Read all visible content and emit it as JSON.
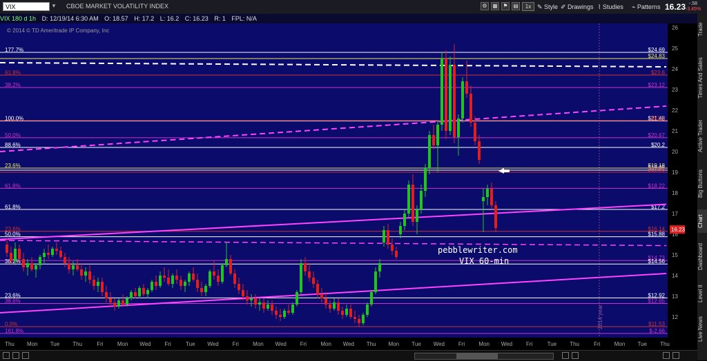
{
  "toolbar": {
    "symbol": "VIX",
    "title": "CBOE MARKET VOLATILITY INDEX",
    "buttons": [
      "1x",
      "Style",
      "Drawings",
      "Studies",
      "Patterns"
    ],
    "last_price": "16.23",
    "change": "-.58",
    "change_pct": "-3.45%"
  },
  "infobar": {
    "name": "VIX 180 d 1h",
    "date": "D: 12/19/14 6:30 AM",
    "open": "O: 18.57",
    "high": "H: 17.2",
    "low": "L: 16.2",
    "close": "C: 16.23",
    "range": "R: 1",
    "fpl": "FPL: N/A"
  },
  "copyright": "© 2014 © TD Ameritrade IP Company, Inc",
  "side_tabs": [
    "Trade",
    "Times And Sales",
    "Active Trader",
    "Big Buttons",
    "Chart",
    "Dashboard",
    "Level II",
    "Live News"
  ],
  "watermark": {
    "site": "pebblewriter.com",
    "caption": "VIX 60-min"
  },
  "vertical_marker": "2014 year",
  "chart_data": {
    "type": "candlestick",
    "ylim": [
      11,
      26.2
    ],
    "y_ticks": [
      12,
      13,
      14,
      15,
      16,
      17,
      18,
      19,
      20,
      21,
      22,
      23,
      24,
      25,
      26
    ],
    "x_labels": [
      "Thu",
      "Mon",
      "Tue",
      "Thu",
      "Fri",
      "Mon",
      "Wed",
      "Fri",
      "Tue",
      "Wed",
      "Fri",
      "Mon",
      "Wed",
      "Fri",
      "Mon",
      "Wed",
      "Thu",
      "Mon",
      "Tue",
      "Wed",
      "Fri",
      "Mon",
      "Wed",
      "Fri",
      "Tue",
      "Thu",
      "Fri",
      "Mon",
      "Tue",
      "Thu"
    ],
    "last_price_tag": "16.23",
    "level_lines": [
      {
        "y": 24.8,
        "left": "177.7%",
        "right": "$24.69",
        "color": "#ffffff"
      },
      {
        "y": 24.5,
        "left": "",
        "right": "$24.83",
        "color": "#e8e860"
      },
      {
        "y": 23.7,
        "left": "61.8%",
        "right": "$23.6",
        "color": "#cc3333"
      },
      {
        "y": 23.1,
        "left": "38.2%",
        "right": "$23.12",
        "color": "#cc33cc"
      },
      {
        "y": 21.48,
        "left": "100.0%",
        "right": "$21.48",
        "color": "#ffffff"
      },
      {
        "y": 21.5,
        "left": "",
        "right": "$21.4",
        "color": "#cc3333"
      },
      {
        "y": 20.67,
        "left": "50.0%",
        "right": "$20.67",
        "color": "#cc33cc"
      },
      {
        "y": 20.2,
        "left": "88.6%",
        "right": "$20.2",
        "color": "#ffffff"
      },
      {
        "y": 19.2,
        "left": "23.6%",
        "right": "$19.18",
        "color": "#e8e860"
      },
      {
        "y": 19.1,
        "left": "",
        "right": "$19.08",
        "color": "#ffffff"
      },
      {
        "y": 19.0,
        "left": "",
        "right": "$18.98",
        "color": "#cc3333"
      },
      {
        "y": 18.22,
        "left": "61.8%",
        "right": "$18.22",
        "color": "#cc33cc"
      },
      {
        "y": 17.2,
        "left": "61.8%",
        "right": "$17.2",
        "color": "#ffffff"
      },
      {
        "y": 16.14,
        "left": "23.6%",
        "right": "$16.14",
        "color": "#cc3333"
      },
      {
        "y": 15.88,
        "left": "50.0%",
        "right": "$15.88",
        "color": "#ffffff"
      },
      {
        "y": 14.73,
        "left": "",
        "right": "$14.73",
        "color": "#cc33cc"
      },
      {
        "y": 14.56,
        "left": "38.2%",
        "right": "$14.56",
        "color": "#ffffff"
      },
      {
        "y": 12.92,
        "left": "23.6%",
        "right": "$12.92",
        "color": "#ffffff"
      },
      {
        "y": 12.65,
        "left": "38.6%",
        "right": "$12.65",
        "color": "#cc33cc"
      },
      {
        "y": 11.53,
        "left": "0.0%",
        "right": "$11.53",
        "color": "#cc3333"
      },
      {
        "y": 11.2,
        "left": "161.8%",
        "right": "$-2.66",
        "color": "#cc33cc"
      }
    ],
    "trendlines": [
      {
        "x": [
          0,
          965
        ],
        "y": [
          15.75,
          17.45
        ],
        "color": "#ff44ff",
        "width": 2,
        "dash": false
      },
      {
        "x": [
          0,
          965
        ],
        "y": [
          12.2,
          14.1
        ],
        "color": "#ff44ff",
        "width": 2,
        "dash": false
      },
      {
        "x": [
          0,
          965
        ],
        "y": [
          20.0,
          22.2
        ],
        "color": "#ff44ff",
        "width": 2,
        "dash": true
      },
      {
        "x": [
          0,
          965
        ],
        "y": [
          15.7,
          15.45
        ],
        "color": "#ff44ff",
        "width": 1.5,
        "dash": true
      },
      {
        "x": [
          0,
          965
        ],
        "y": [
          24.3,
          24.1
        ],
        "color": "#ffffff",
        "width": 2,
        "dash": true
      }
    ],
    "candles": [
      {
        "x": 10,
        "o": 15.5,
        "h": 15.8,
        "l": 14.9,
        "c": 15.1
      },
      {
        "x": 16,
        "o": 15.1,
        "h": 15.4,
        "l": 14.5,
        "c": 14.7
      },
      {
        "x": 22,
        "o": 14.7,
        "h": 15.6,
        "l": 14.5,
        "c": 15.3
      },
      {
        "x": 28,
        "o": 15.3,
        "h": 15.5,
        "l": 14.6,
        "c": 14.8
      },
      {
        "x": 34,
        "o": 14.8,
        "h": 15.1,
        "l": 14.2,
        "c": 14.4
      },
      {
        "x": 40,
        "o": 14.4,
        "h": 14.8,
        "l": 14.0,
        "c": 14.6
      },
      {
        "x": 46,
        "o": 14.6,
        "h": 14.9,
        "l": 14.2,
        "c": 14.3
      },
      {
        "x": 52,
        "o": 14.3,
        "h": 14.6,
        "l": 13.9,
        "c": 14.5
      },
      {
        "x": 58,
        "o": 14.5,
        "h": 15.0,
        "l": 14.3,
        "c": 14.9
      },
      {
        "x": 64,
        "o": 14.9,
        "h": 15.3,
        "l": 14.6,
        "c": 15.1
      },
      {
        "x": 70,
        "o": 15.1,
        "h": 15.5,
        "l": 14.8,
        "c": 15.0
      },
      {
        "x": 76,
        "o": 15.0,
        "h": 15.4,
        "l": 14.9,
        "c": 15.3
      },
      {
        "x": 82,
        "o": 15.3,
        "h": 15.6,
        "l": 15.0,
        "c": 15.2
      },
      {
        "x": 88,
        "o": 15.2,
        "h": 15.4,
        "l": 14.8,
        "c": 14.9
      },
      {
        "x": 94,
        "o": 14.9,
        "h": 15.1,
        "l": 14.4,
        "c": 14.6
      },
      {
        "x": 100,
        "o": 14.6,
        "h": 14.9,
        "l": 14.1,
        "c": 14.3
      },
      {
        "x": 106,
        "o": 14.3,
        "h": 14.7,
        "l": 14.0,
        "c": 14.5
      },
      {
        "x": 112,
        "o": 14.5,
        "h": 14.8,
        "l": 14.2,
        "c": 14.3
      },
      {
        "x": 118,
        "o": 14.3,
        "h": 14.6,
        "l": 13.8,
        "c": 14.0
      },
      {
        "x": 124,
        "o": 14.0,
        "h": 14.4,
        "l": 13.7,
        "c": 14.2
      },
      {
        "x": 130,
        "o": 14.2,
        "h": 14.5,
        "l": 13.6,
        "c": 13.8
      },
      {
        "x": 136,
        "o": 13.8,
        "h": 14.0,
        "l": 13.3,
        "c": 13.5
      },
      {
        "x": 142,
        "o": 13.5,
        "h": 13.9,
        "l": 13.2,
        "c": 13.7
      },
      {
        "x": 148,
        "o": 13.7,
        "h": 13.9,
        "l": 13.0,
        "c": 13.2
      },
      {
        "x": 154,
        "o": 13.2,
        "h": 13.5,
        "l": 12.7,
        "c": 12.9
      },
      {
        "x": 160,
        "o": 12.9,
        "h": 13.2,
        "l": 12.5,
        "c": 12.7
      },
      {
        "x": 166,
        "o": 12.7,
        "h": 12.9,
        "l": 12.3,
        "c": 12.5
      },
      {
        "x": 172,
        "o": 12.5,
        "h": 12.9,
        "l": 12.4,
        "c": 12.8
      },
      {
        "x": 178,
        "o": 12.8,
        "h": 13.1,
        "l": 12.5,
        "c": 12.6
      },
      {
        "x": 184,
        "o": 12.6,
        "h": 13.0,
        "l": 12.5,
        "c": 12.9
      },
      {
        "x": 190,
        "o": 12.9,
        "h": 13.3,
        "l": 12.8,
        "c": 13.2
      },
      {
        "x": 196,
        "o": 13.2,
        "h": 13.4,
        "l": 12.9,
        "c": 13.0
      },
      {
        "x": 202,
        "o": 13.0,
        "h": 13.5,
        "l": 12.9,
        "c": 13.4
      },
      {
        "x": 208,
        "o": 13.4,
        "h": 13.6,
        "l": 13.0,
        "c": 13.1
      },
      {
        "x": 214,
        "o": 13.1,
        "h": 13.4,
        "l": 12.9,
        "c": 13.3
      },
      {
        "x": 220,
        "o": 13.3,
        "h": 13.8,
        "l": 13.2,
        "c": 13.7
      },
      {
        "x": 226,
        "o": 13.7,
        "h": 14.0,
        "l": 13.3,
        "c": 13.5
      },
      {
        "x": 232,
        "o": 13.5,
        "h": 14.2,
        "l": 13.4,
        "c": 14.0
      },
      {
        "x": 238,
        "o": 14.0,
        "h": 14.4,
        "l": 13.7,
        "c": 13.9
      },
      {
        "x": 244,
        "o": 13.9,
        "h": 14.3,
        "l": 13.5,
        "c": 13.6
      },
      {
        "x": 250,
        "o": 13.6,
        "h": 14.1,
        "l": 13.4,
        "c": 14.0
      },
      {
        "x": 256,
        "o": 14.0,
        "h": 14.3,
        "l": 13.6,
        "c": 13.8
      },
      {
        "x": 262,
        "o": 13.8,
        "h": 14.0,
        "l": 13.3,
        "c": 13.5
      },
      {
        "x": 268,
        "o": 13.5,
        "h": 13.8,
        "l": 13.2,
        "c": 13.7
      },
      {
        "x": 274,
        "o": 13.7,
        "h": 14.2,
        "l": 13.5,
        "c": 14.1
      },
      {
        "x": 280,
        "o": 14.1,
        "h": 14.4,
        "l": 13.7,
        "c": 13.8
      },
      {
        "x": 286,
        "o": 13.8,
        "h": 14.1,
        "l": 13.2,
        "c": 13.4
      },
      {
        "x": 292,
        "o": 13.4,
        "h": 13.7,
        "l": 13.0,
        "c": 13.2
      },
      {
        "x": 298,
        "o": 13.2,
        "h": 13.6,
        "l": 13.0,
        "c": 13.5
      },
      {
        "x": 304,
        "o": 13.5,
        "h": 14.3,
        "l": 13.4,
        "c": 14.2
      },
      {
        "x": 310,
        "o": 14.2,
        "h": 14.7,
        "l": 13.8,
        "c": 14.0
      },
      {
        "x": 316,
        "o": 14.0,
        "h": 14.3,
        "l": 13.5,
        "c": 13.7
      },
      {
        "x": 322,
        "o": 13.7,
        "h": 14.6,
        "l": 13.6,
        "c": 14.5
      },
      {
        "x": 328,
        "o": 14.5,
        "h": 15.6,
        "l": 14.4,
        "c": 14.8
      },
      {
        "x": 334,
        "o": 14.8,
        "h": 15.0,
        "l": 14.0,
        "c": 14.1
      },
      {
        "x": 340,
        "o": 14.1,
        "h": 14.3,
        "l": 13.4,
        "c": 13.6
      },
      {
        "x": 346,
        "o": 13.6,
        "h": 13.9,
        "l": 13.1,
        "c": 13.3
      },
      {
        "x": 352,
        "o": 13.3,
        "h": 13.6,
        "l": 12.8,
        "c": 13.0
      },
      {
        "x": 358,
        "o": 13.0,
        "h": 13.3,
        "l": 12.6,
        "c": 12.8
      },
      {
        "x": 364,
        "o": 12.8,
        "h": 13.1,
        "l": 12.5,
        "c": 12.9
      },
      {
        "x": 370,
        "o": 12.9,
        "h": 13.1,
        "l": 12.4,
        "c": 12.6
      },
      {
        "x": 376,
        "o": 12.6,
        "h": 12.9,
        "l": 12.3,
        "c": 12.7
      },
      {
        "x": 382,
        "o": 12.7,
        "h": 12.9,
        "l": 12.2,
        "c": 12.4
      },
      {
        "x": 388,
        "o": 12.4,
        "h": 12.8,
        "l": 12.3,
        "c": 12.6
      },
      {
        "x": 394,
        "o": 12.6,
        "h": 12.8,
        "l": 12.1,
        "c": 12.3
      },
      {
        "x": 400,
        "o": 12.3,
        "h": 12.5,
        "l": 11.9,
        "c": 12.1
      },
      {
        "x": 406,
        "o": 12.1,
        "h": 12.4,
        "l": 11.8,
        "c": 12.0
      },
      {
        "x": 412,
        "o": 12.0,
        "h": 12.4,
        "l": 11.9,
        "c": 12.3
      },
      {
        "x": 418,
        "o": 12.3,
        "h": 12.6,
        "l": 12.1,
        "c": 12.2
      },
      {
        "x": 424,
        "o": 12.2,
        "h": 12.7,
        "l": 12.1,
        "c": 12.6
      },
      {
        "x": 430,
        "o": 12.6,
        "h": 13.3,
        "l": 12.5,
        "c": 13.2
      },
      {
        "x": 436,
        "o": 13.2,
        "h": 14.8,
        "l": 13.1,
        "c": 14.6
      },
      {
        "x": 442,
        "o": 14.6,
        "h": 14.9,
        "l": 14.0,
        "c": 14.2
      },
      {
        "x": 448,
        "o": 14.2,
        "h": 14.6,
        "l": 13.7,
        "c": 13.9
      },
      {
        "x": 454,
        "o": 13.9,
        "h": 14.2,
        "l": 13.4,
        "c": 13.6
      },
      {
        "x": 460,
        "o": 13.6,
        "h": 13.8,
        "l": 12.9,
        "c": 13.1
      },
      {
        "x": 466,
        "o": 13.1,
        "h": 13.4,
        "l": 12.7,
        "c": 12.9
      },
      {
        "x": 472,
        "o": 12.9,
        "h": 13.2,
        "l": 12.4,
        "c": 12.6
      },
      {
        "x": 478,
        "o": 12.6,
        "h": 12.8,
        "l": 12.2,
        "c": 12.4
      },
      {
        "x": 484,
        "o": 12.4,
        "h": 12.9,
        "l": 12.3,
        "c": 12.7
      },
      {
        "x": 490,
        "o": 12.7,
        "h": 12.9,
        "l": 12.1,
        "c": 12.3
      },
      {
        "x": 496,
        "o": 12.3,
        "h": 12.5,
        "l": 11.9,
        "c": 12.1
      },
      {
        "x": 502,
        "o": 12.1,
        "h": 12.6,
        "l": 12.0,
        "c": 12.4
      },
      {
        "x": 508,
        "o": 12.4,
        "h": 12.6,
        "l": 11.9,
        "c": 12.0
      },
      {
        "x": 514,
        "o": 12.0,
        "h": 12.3,
        "l": 11.7,
        "c": 11.9
      },
      {
        "x": 520,
        "o": 11.9,
        "h": 12.1,
        "l": 11.5,
        "c": 11.7
      },
      {
        "x": 526,
        "o": 11.7,
        "h": 12.2,
        "l": 11.6,
        "c": 12.1
      },
      {
        "x": 532,
        "o": 12.1,
        "h": 12.7,
        "l": 12.0,
        "c": 12.6
      },
      {
        "x": 538,
        "o": 12.6,
        "h": 13.3,
        "l": 12.5,
        "c": 13.2
      },
      {
        "x": 544,
        "o": 13.2,
        "h": 14.4,
        "l": 13.1,
        "c": 14.2
      },
      {
        "x": 550,
        "o": 14.2,
        "h": 14.8,
        "l": 13.9,
        "c": 14.6
      },
      {
        "x": 556,
        "o": 15.6,
        "h": 16.4,
        "l": 15.4,
        "c": 16.2
      },
      {
        "x": 562,
        "o": 16.2,
        "h": 16.5,
        "l": 15.3,
        "c": 15.5
      },
      {
        "x": 568,
        "o": 15.5,
        "h": 15.8,
        "l": 15.0,
        "c": 15.2
      },
      {
        "x": 574,
        "o": 15.2,
        "h": 15.4,
        "l": 14.8,
        "c": 14.9
      },
      {
        "x": 580,
        "o": 16.0,
        "h": 16.6,
        "l": 15.8,
        "c": 16.4
      },
      {
        "x": 586,
        "o": 16.4,
        "h": 17.2,
        "l": 16.2,
        "c": 17.0
      },
      {
        "x": 592,
        "o": 17.0,
        "h": 18.6,
        "l": 16.8,
        "c": 18.4
      },
      {
        "x": 598,
        "o": 18.4,
        "h": 18.9,
        "l": 16.4,
        "c": 16.6
      },
      {
        "x": 604,
        "o": 16.6,
        "h": 17.4,
        "l": 16.0,
        "c": 17.2
      },
      {
        "x": 610,
        "o": 17.2,
        "h": 18.4,
        "l": 17.0,
        "c": 18.1
      },
      {
        "x": 616,
        "o": 18.1,
        "h": 19.4,
        "l": 17.8,
        "c": 19.2
      },
      {
        "x": 622,
        "o": 19.2,
        "h": 21.0,
        "l": 18.9,
        "c": 20.8
      },
      {
        "x": 628,
        "o": 20.8,
        "h": 21.3,
        "l": 20.1,
        "c": 20.3
      },
      {
        "x": 634,
        "o": 20.3,
        "h": 21.5,
        "l": 19.0,
        "c": 21.3
      },
      {
        "x": 640,
        "o": 21.3,
        "h": 24.8,
        "l": 21.0,
        "c": 24.5
      },
      {
        "x": 646,
        "o": 24.5,
        "h": 24.9,
        "l": 20.6,
        "c": 21.0
      },
      {
        "x": 652,
        "o": 21.0,
        "h": 24.6,
        "l": 20.8,
        "c": 24.2
      },
      {
        "x": 658,
        "o": 24.2,
        "h": 25.2,
        "l": 20.4,
        "c": 20.7
      },
      {
        "x": 664,
        "o": 20.7,
        "h": 21.8,
        "l": 19.8,
        "c": 21.6
      },
      {
        "x": 670,
        "o": 21.6,
        "h": 23.6,
        "l": 21.4,
        "c": 23.4
      },
      {
        "x": 676,
        "o": 23.4,
        "h": 24.4,
        "l": 22.6,
        "c": 22.8
      },
      {
        "x": 682,
        "o": 22.8,
        "h": 23.2,
        "l": 21.2,
        "c": 21.4
      },
      {
        "x": 688,
        "o": 21.4,
        "h": 21.7,
        "l": 20.3,
        "c": 20.5
      },
      {
        "x": 694,
        "o": 20.5,
        "h": 20.8,
        "l": 19.4,
        "c": 19.6
      },
      {
        "x": 700,
        "o": 17.6,
        "h": 18.2,
        "l": 16.1,
        "c": 17.8
      },
      {
        "x": 706,
        "o": 17.8,
        "h": 18.4,
        "l": 17.4,
        "c": 18.2
      },
      {
        "x": 712,
        "o": 18.2,
        "h": 18.5,
        "l": 17.2,
        "c": 17.4
      },
      {
        "x": 718,
        "o": 17.4,
        "h": 17.6,
        "l": 16.1,
        "c": 16.3
      }
    ]
  }
}
